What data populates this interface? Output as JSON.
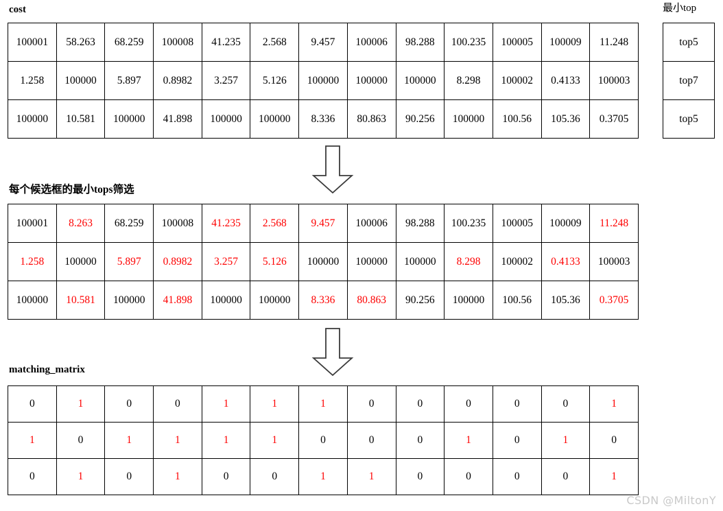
{
  "labels": {
    "cost": "cost",
    "filter": "每个候选框的最小tops筛选",
    "matching": "matching_matrix",
    "min_top": "最小top"
  },
  "watermark": "CSDN @MiltonY",
  "icons": {
    "arrow_1": "arrow-down-block-icon",
    "arrow_2": "arrow-down-block-icon"
  },
  "colors": {
    "highlight": "#fe0000",
    "text": "#000000",
    "border": "#000000",
    "watermark": "#c9c9c9",
    "background": "#ffffff"
  },
  "chart_data": {
    "type": "table",
    "title": "cost / 最小tops筛选 / matching_matrix 流程图",
    "tables": [
      {
        "name": "cost",
        "label": "cost",
        "rows": 3,
        "cols": 13,
        "values": [
          [
            "100001",
            "58.263",
            "68.259",
            "100008",
            "41.235",
            "2.568",
            "9.457",
            "100006",
            "98.288",
            "100.235",
            "100005",
            "100009",
            "11.248"
          ],
          [
            "1.258",
            "100000",
            "5.897",
            "0.8982",
            "3.257",
            "5.126",
            "100000",
            "100000",
            "100000",
            "8.298",
            "100002",
            "0.4133",
            "100003"
          ],
          [
            "100000",
            "10.581",
            "100000",
            "41.898",
            "100000",
            "100000",
            "8.336",
            "80.863",
            "90.256",
            "100000",
            "100.56",
            "105.36",
            "0.3705"
          ]
        ],
        "highlight": [
          [
            false,
            false,
            false,
            false,
            false,
            false,
            false,
            false,
            false,
            false,
            false,
            false,
            false
          ],
          [
            false,
            false,
            false,
            false,
            false,
            false,
            false,
            false,
            false,
            false,
            false,
            false,
            false
          ],
          [
            false,
            false,
            false,
            false,
            false,
            false,
            false,
            false,
            false,
            false,
            false,
            false,
            false
          ]
        ]
      },
      {
        "name": "filter",
        "label": "每个候选框的最小tops筛选",
        "rows": 3,
        "cols": 13,
        "values": [
          [
            "100001",
            "8.263",
            "68.259",
            "100008",
            "41.235",
            "2.568",
            "9.457",
            "100006",
            "98.288",
            "100.235",
            "100005",
            "100009",
            "11.248"
          ],
          [
            "1.258",
            "100000",
            "5.897",
            "0.8982",
            "3.257",
            "5.126",
            "100000",
            "100000",
            "100000",
            "8.298",
            "100002",
            "0.4133",
            "100003"
          ],
          [
            "100000",
            "10.581",
            "100000",
            "41.898",
            "100000",
            "100000",
            "8.336",
            "80.863",
            "90.256",
            "100000",
            "100.56",
            "105.36",
            "0.3705"
          ]
        ],
        "highlight": [
          [
            false,
            true,
            false,
            false,
            true,
            true,
            true,
            false,
            false,
            false,
            false,
            false,
            true
          ],
          [
            true,
            false,
            true,
            true,
            true,
            true,
            false,
            false,
            false,
            true,
            false,
            true,
            false
          ],
          [
            false,
            true,
            false,
            true,
            false,
            false,
            true,
            true,
            false,
            false,
            false,
            false,
            true
          ]
        ]
      },
      {
        "name": "matching_matrix",
        "label": "matching_matrix",
        "rows": 3,
        "cols": 13,
        "values": [
          [
            "0",
            "1",
            "0",
            "0",
            "1",
            "1",
            "1",
            "0",
            "0",
            "0",
            "0",
            "0",
            "1"
          ],
          [
            "1",
            "0",
            "1",
            "1",
            "1",
            "1",
            "0",
            "0",
            "0",
            "1",
            "0",
            "1",
            "0"
          ],
          [
            "0",
            "1",
            "0",
            "1",
            "0",
            "0",
            "1",
            "1",
            "0",
            "0",
            "0",
            "0",
            "1"
          ]
        ],
        "highlight": [
          [
            false,
            true,
            false,
            false,
            true,
            true,
            true,
            false,
            false,
            false,
            false,
            false,
            true
          ],
          [
            true,
            false,
            true,
            true,
            true,
            true,
            false,
            false,
            false,
            true,
            false,
            true,
            false
          ],
          [
            false,
            true,
            false,
            true,
            false,
            false,
            true,
            true,
            false,
            false,
            false,
            false,
            true
          ]
        ]
      },
      {
        "name": "min_top",
        "label": "最小top",
        "rows": 3,
        "cols": 1,
        "values": [
          [
            "top5"
          ],
          [
            "top7"
          ],
          [
            "top5"
          ]
        ],
        "highlight": [
          [
            false
          ],
          [
            false
          ],
          [
            false
          ]
        ]
      }
    ]
  }
}
